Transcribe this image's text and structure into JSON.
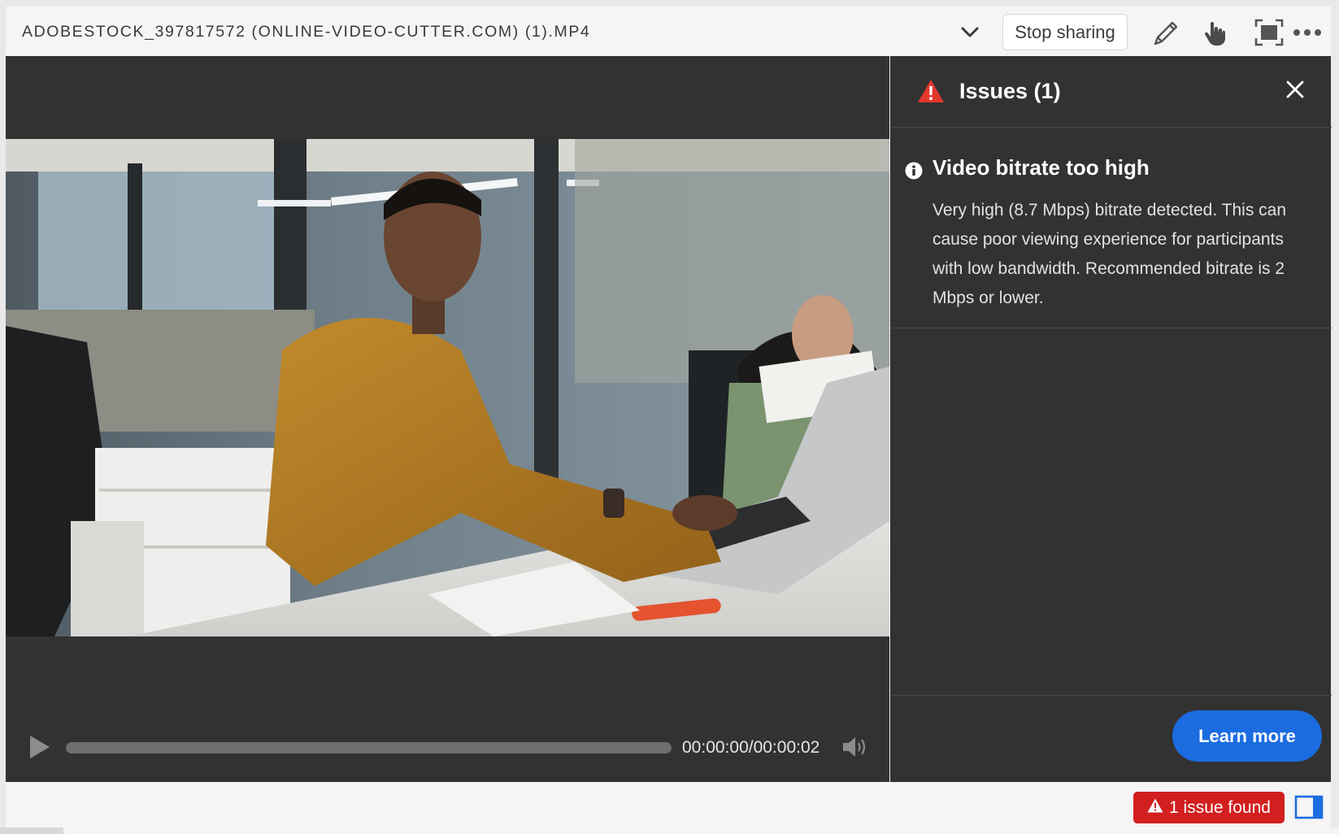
{
  "titlebar": {
    "file_title": "ADOBESTOCK_397817572 (ONLINE-VIDEO-CUTTER.COM) (1).MP4",
    "stop_sharing_label": "Stop sharing",
    "icons": [
      "chevron-down-icon",
      "pen-icon",
      "pointer-hand-icon",
      "fullscreen-icon",
      "more-icon"
    ]
  },
  "player": {
    "timecode": "00:00:00/00:00:02",
    "progress": 0,
    "icons": [
      "play-icon",
      "volume-icon"
    ]
  },
  "issues_panel": {
    "title": "Issues (1)",
    "issues": [
      {
        "title": "Video bitrate too high",
        "description": "Very high (8.7 Mbps) bitrate detected. This can cause poor viewing experience for participants with low bandwidth. Recommended bitrate is 2 Mbps or lower."
      }
    ],
    "learn_more_label": "Learn more"
  },
  "statusbar": {
    "issue_badge_label": "1 issue found",
    "icons": [
      "warning-icon",
      "panel-toggle-icon"
    ]
  },
  "colors": {
    "accent_blue": "#1b6ce0",
    "error_red": "#d21f1f",
    "warning_red": "#e3372d",
    "panel_bg": "#323232"
  }
}
